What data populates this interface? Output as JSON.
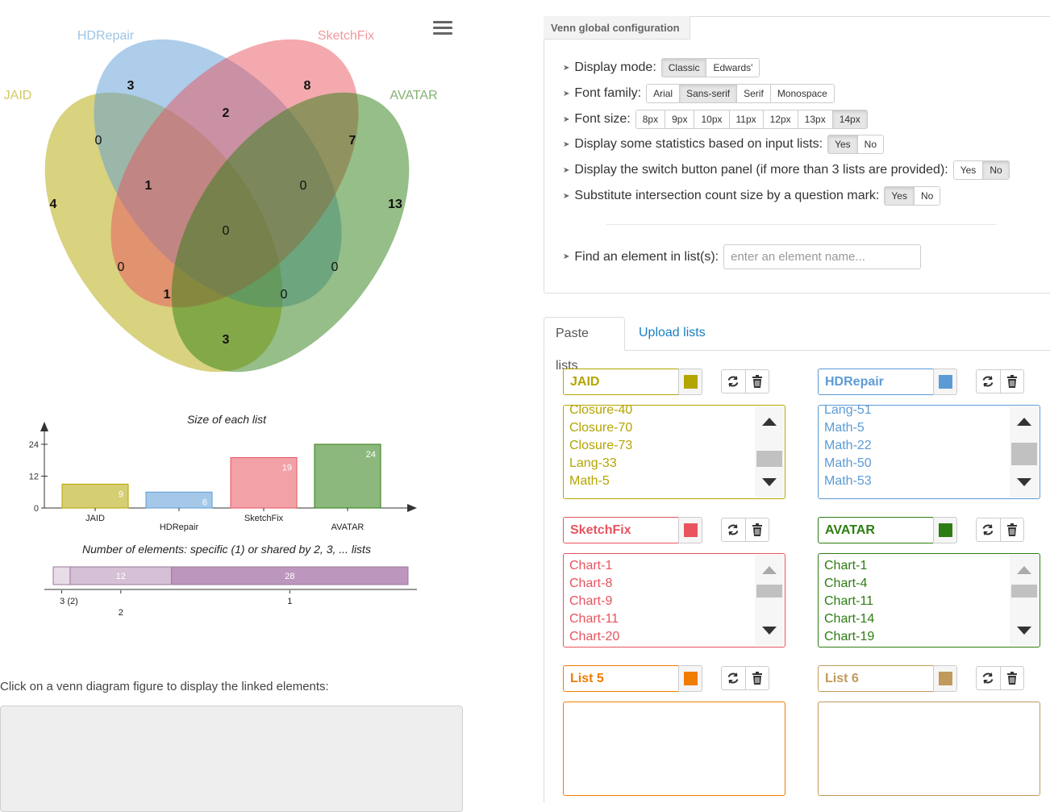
{
  "venn": {
    "set_labels": [
      {
        "name": "JAID",
        "color": "#b3a500"
      },
      {
        "name": "HDRepair",
        "color": "#5b9bd5"
      },
      {
        "name": "SketchFix",
        "color": "#e8535e"
      },
      {
        "name": "AVATAR",
        "color": "#2e7d12"
      }
    ],
    "counts": [
      {
        "id": "jaid-only",
        "value": "4",
        "bold": true
      },
      {
        "id": "hdrepair-only",
        "value": "3",
        "bold": true
      },
      {
        "id": "sketchfix-only",
        "value": "8",
        "bold": true
      },
      {
        "id": "avatar-only",
        "value": "13",
        "bold": true
      },
      {
        "id": "hd-sf",
        "value": "2",
        "bold": true
      },
      {
        "id": "jaid-hd",
        "value": "0",
        "bold": false
      },
      {
        "id": "sf-av",
        "value": "7",
        "bold": true
      },
      {
        "id": "jaid-hd-sf",
        "value": "1",
        "bold": true
      },
      {
        "id": "hd-sf-av",
        "value": "0",
        "bold": false
      },
      {
        "id": "all",
        "value": "0",
        "bold": false
      },
      {
        "id": "jaid-sf",
        "value": "0",
        "bold": false
      },
      {
        "id": "hd-av",
        "value": "0",
        "bold": false
      },
      {
        "id": "jaid-sf-av",
        "value": "1",
        "bold": true
      },
      {
        "id": "jaid-hd-av",
        "value": "0",
        "bold": false
      },
      {
        "id": "jaid-av",
        "value": "3",
        "bold": true
      }
    ]
  },
  "chart_data": [
    {
      "type": "bar",
      "title": "Size of each list",
      "categories": [
        "JAID",
        "HDRepair",
        "SketchFix",
        "AVATAR"
      ],
      "values": [
        9,
        6,
        19,
        24
      ],
      "yticks": [
        0,
        12,
        24
      ],
      "ylim": [
        0,
        24
      ]
    },
    {
      "type": "bar",
      "title": "Number of elements: specific (1) or shared by 2, 3, ... lists",
      "categories": [
        "3 (2)",
        "2",
        "1"
      ],
      "values": [
        2,
        12,
        28
      ],
      "stacked": true
    }
  ],
  "left": {
    "click_label": "Click on a venn diagram figure to display the linked elements:"
  },
  "config": {
    "title": "Venn global configuration",
    "rows": [
      {
        "label": "Display mode:",
        "options": [
          "Classic",
          "Edwards'"
        ],
        "active": 0
      },
      {
        "label": "Font family:",
        "options": [
          "Arial",
          "Sans-serif",
          "Serif",
          "Monospace"
        ],
        "active": 1
      },
      {
        "label": "Font size:",
        "options": [
          "8px",
          "9px",
          "10px",
          "11px",
          "12px",
          "13px",
          "14px"
        ],
        "active": 6
      },
      {
        "label": "Display some statistics based on input lists:",
        "options": [
          "Yes",
          "No"
        ],
        "active": 0
      },
      {
        "label": "Display the switch button panel (if more than 3 lists are provided):",
        "options": [
          "Yes",
          "No"
        ],
        "active": 1
      },
      {
        "label": "Substitute intersection count size by a question mark:",
        "options": [
          "Yes",
          "No"
        ],
        "active": 0
      }
    ],
    "find_label": "Find an element in list(s):",
    "find_placeholder": "enter an element name..."
  },
  "tabs": [
    "Paste lists",
    "Upload lists"
  ],
  "lists": [
    {
      "name": "JAID",
      "color": "#b3a500",
      "items": [
        "Closure-40",
        "Closure-70",
        "Closure-73",
        "Lang-33",
        "Math-5"
      ]
    },
    {
      "name": "HDRepair",
      "color": "#5b9bd5",
      "items": [
        "Lang-51",
        "Math-5",
        "Math-22",
        "Math-50",
        "Math-53"
      ]
    },
    {
      "name": "SketchFix",
      "color": "#e8535e",
      "items": [
        "Chart-1",
        "Chart-8",
        "Chart-9",
        "Chart-11",
        "Chart-20"
      ]
    },
    {
      "name": "AVATAR",
      "color": "#2e7d12",
      "items": [
        "Chart-1",
        "Chart-4",
        "Chart-11",
        "Chart-14",
        "Chart-19"
      ]
    },
    {
      "name": "List 5",
      "color": "#f07c00",
      "items": []
    },
    {
      "name": "List 6",
      "color": "#c09a5b",
      "items": []
    }
  ]
}
